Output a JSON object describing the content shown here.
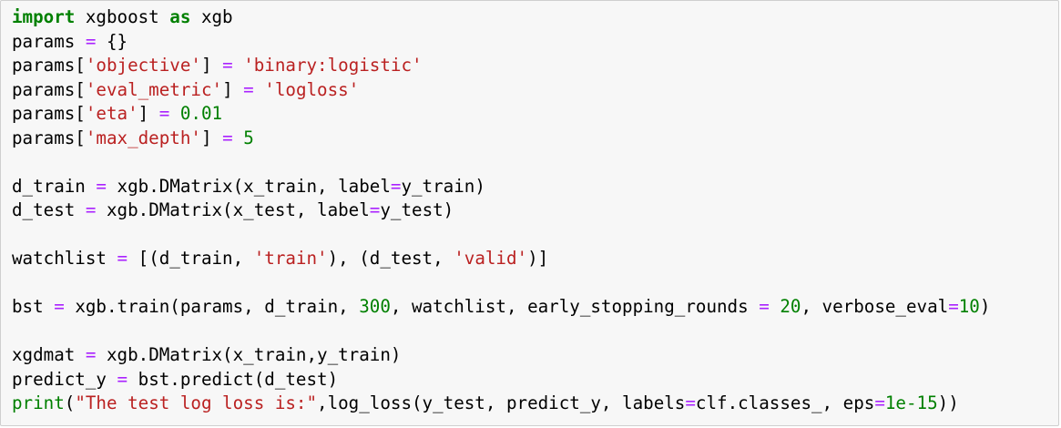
{
  "editor": {
    "lines": [
      [
        {
          "t": "import",
          "c": "kw"
        },
        {
          "t": " xgboost "
        },
        {
          "t": "as",
          "c": "kw"
        },
        {
          "t": " xgb"
        }
      ],
      [
        {
          "t": "params "
        },
        {
          "t": "=",
          "c": "op"
        },
        {
          "t": " {}"
        }
      ],
      [
        {
          "t": "params["
        },
        {
          "t": "'objective'",
          "c": "str"
        },
        {
          "t": "] "
        },
        {
          "t": "=",
          "c": "op"
        },
        {
          "t": " "
        },
        {
          "t": "'binary:logistic'",
          "c": "str"
        }
      ],
      [
        {
          "t": "params["
        },
        {
          "t": "'eval_metric'",
          "c": "str"
        },
        {
          "t": "] "
        },
        {
          "t": "=",
          "c": "op"
        },
        {
          "t": " "
        },
        {
          "t": "'logloss'",
          "c": "str"
        }
      ],
      [
        {
          "t": "params["
        },
        {
          "t": "'eta'",
          "c": "str"
        },
        {
          "t": "] "
        },
        {
          "t": "=",
          "c": "op"
        },
        {
          "t": " "
        },
        {
          "t": "0.01",
          "c": "num"
        }
      ],
      [
        {
          "t": "params["
        },
        {
          "t": "'max_depth'",
          "c": "str"
        },
        {
          "t": "] "
        },
        {
          "t": "=",
          "c": "op"
        },
        {
          "t": " "
        },
        {
          "t": "5",
          "c": "num"
        }
      ],
      [],
      [
        {
          "t": "d_train "
        },
        {
          "t": "=",
          "c": "op"
        },
        {
          "t": " xgb.DMatrix(x_train, label"
        },
        {
          "t": "=",
          "c": "op"
        },
        {
          "t": "y_train)"
        }
      ],
      [
        {
          "t": "d_test "
        },
        {
          "t": "=",
          "c": "op"
        },
        {
          "t": " xgb.DMatrix(x_test, label"
        },
        {
          "t": "=",
          "c": "op"
        },
        {
          "t": "y_test)"
        }
      ],
      [],
      [
        {
          "t": "watchlist "
        },
        {
          "t": "=",
          "c": "op"
        },
        {
          "t": " [(d_train, "
        },
        {
          "t": "'train'",
          "c": "str"
        },
        {
          "t": "), (d_test, "
        },
        {
          "t": "'valid'",
          "c": "str"
        },
        {
          "t": ")]"
        }
      ],
      [],
      [
        {
          "t": "bst "
        },
        {
          "t": "=",
          "c": "op"
        },
        {
          "t": " xgb.train(params, d_train, "
        },
        {
          "t": "300",
          "c": "num"
        },
        {
          "t": ", watchlist, early_stopping_rounds "
        },
        {
          "t": "=",
          "c": "op"
        },
        {
          "t": " "
        },
        {
          "t": "20",
          "c": "num"
        },
        {
          "t": ", verbose_eval"
        },
        {
          "t": "=",
          "c": "op"
        },
        {
          "t": "10",
          "c": "num"
        },
        {
          "t": ")"
        }
      ],
      [],
      [
        {
          "t": "xgdmat "
        },
        {
          "t": "=",
          "c": "op"
        },
        {
          "t": " xgb.DMatrix(x_train,y_train)"
        }
      ],
      [
        {
          "t": "predict_y "
        },
        {
          "t": "=",
          "c": "op"
        },
        {
          "t": " bst.predict(d_test)"
        }
      ],
      [
        {
          "t": "print",
          "c": "bi"
        },
        {
          "t": "("
        },
        {
          "t": "\"The test log loss is:\"",
          "c": "str"
        },
        {
          "t": ",log_loss(y_test, predict_y, labels"
        },
        {
          "t": "=",
          "c": "op"
        },
        {
          "t": "clf.classes_, eps"
        },
        {
          "t": "=",
          "c": "op"
        },
        {
          "t": "1e-15",
          "c": "num"
        },
        {
          "t": "))"
        }
      ]
    ]
  }
}
